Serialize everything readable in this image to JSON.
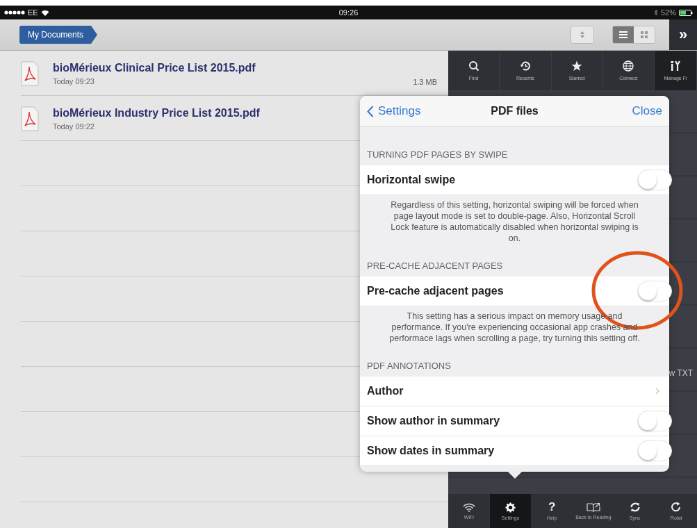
{
  "status_bar": {
    "carrier": "EE",
    "time": "09:26",
    "battery": "52%"
  },
  "nav_bar": {
    "breadcrumb": "My Documents",
    "view_modes": [
      {
        "kind": "list",
        "selected": true
      },
      {
        "kind": "grid",
        "selected": false
      }
    ],
    "more": "»"
  },
  "files": [
    {
      "name": "bioMérieux Clinical Price List 2015.pdf",
      "date": "Today 09:23",
      "size": "1.3 MB"
    },
    {
      "name": "bioMérieux Industry Price List 2015.pdf",
      "date": "Today 09:22"
    }
  ],
  "top_toolbar": [
    {
      "kind": "find",
      "label": "Find"
    },
    {
      "kind": "recents",
      "label": "Recents"
    },
    {
      "kind": "starred",
      "label": "Starred"
    },
    {
      "kind": "connect",
      "label": "Connect"
    },
    {
      "kind": "manage",
      "label": "Manage Fi"
    }
  ],
  "panel_partial_text": "w TXT",
  "popover": {
    "back": "Settings",
    "title": "PDF files",
    "close": "Close",
    "rows": [
      {
        "kind": "section",
        "text": "TURNING PDF PAGES BY SWIPE"
      },
      {
        "kind": "toggle",
        "text": "Horizontal swipe",
        "on": false
      },
      {
        "kind": "note",
        "text": "Regardless of this setting, horizontal swiping will be forced when page layout mode is set to double-page. Also, Horizontal Scroll Lock feature is automatically disabled when horizontal swiping is on."
      },
      {
        "kind": "section",
        "text": "PRE-CACHE ADJACENT PAGES"
      },
      {
        "kind": "toggle",
        "text": "Pre-cache adjacent pages",
        "on": false
      },
      {
        "kind": "note",
        "text": "This setting has a serious impact on memory usage and performance. If you're experiencing occasional app crashes and performace lags when scrolling a page, try turning this setting off."
      },
      {
        "kind": "section",
        "text": "PDF ANNOTATIONS"
      },
      {
        "kind": "disclosure",
        "text": "Author"
      },
      {
        "kind": "toggle",
        "text": "Show author in summary",
        "on": false
      },
      {
        "kind": "toggle",
        "text": "Show dates in summary",
        "on": false
      }
    ]
  },
  "bottom_toolbar": [
    {
      "kind": "wifi",
      "label": "WiFi",
      "selected": false
    },
    {
      "kind": "settings",
      "label": "Settings",
      "selected": true
    },
    {
      "kind": "help",
      "glyph": "?",
      "label": "Help",
      "selected": false
    },
    {
      "kind": "reading",
      "label": "Back to Reading",
      "selected": false
    },
    {
      "kind": "sync",
      "label": "Sync",
      "selected": false
    },
    {
      "kind": "rotate",
      "label": "Rotat",
      "selected": false
    }
  ]
}
